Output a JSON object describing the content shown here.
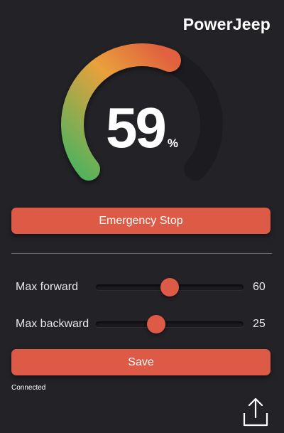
{
  "app": {
    "title": "PowerJeep"
  },
  "gauge": {
    "value": "59",
    "fraction": 0.59,
    "unit": "%",
    "colors": {
      "low": "#4cb35f",
      "mid": "#e9a13c",
      "high": "#e0603f",
      "track": "#1c1b20"
    }
  },
  "controls": {
    "emergency_label": "Emergency Stop",
    "save_label": "Save"
  },
  "sliders": [
    {
      "label": "Max forward",
      "value": "60",
      "fraction": 0.5
    },
    {
      "label": "Max backward",
      "value": "25",
      "fraction": 0.41
    }
  ],
  "status": {
    "text": "Connected"
  },
  "icons": {
    "share": "share-upload-icon"
  },
  "theme": {
    "background": "#232227",
    "accent": "#dd5a47"
  }
}
